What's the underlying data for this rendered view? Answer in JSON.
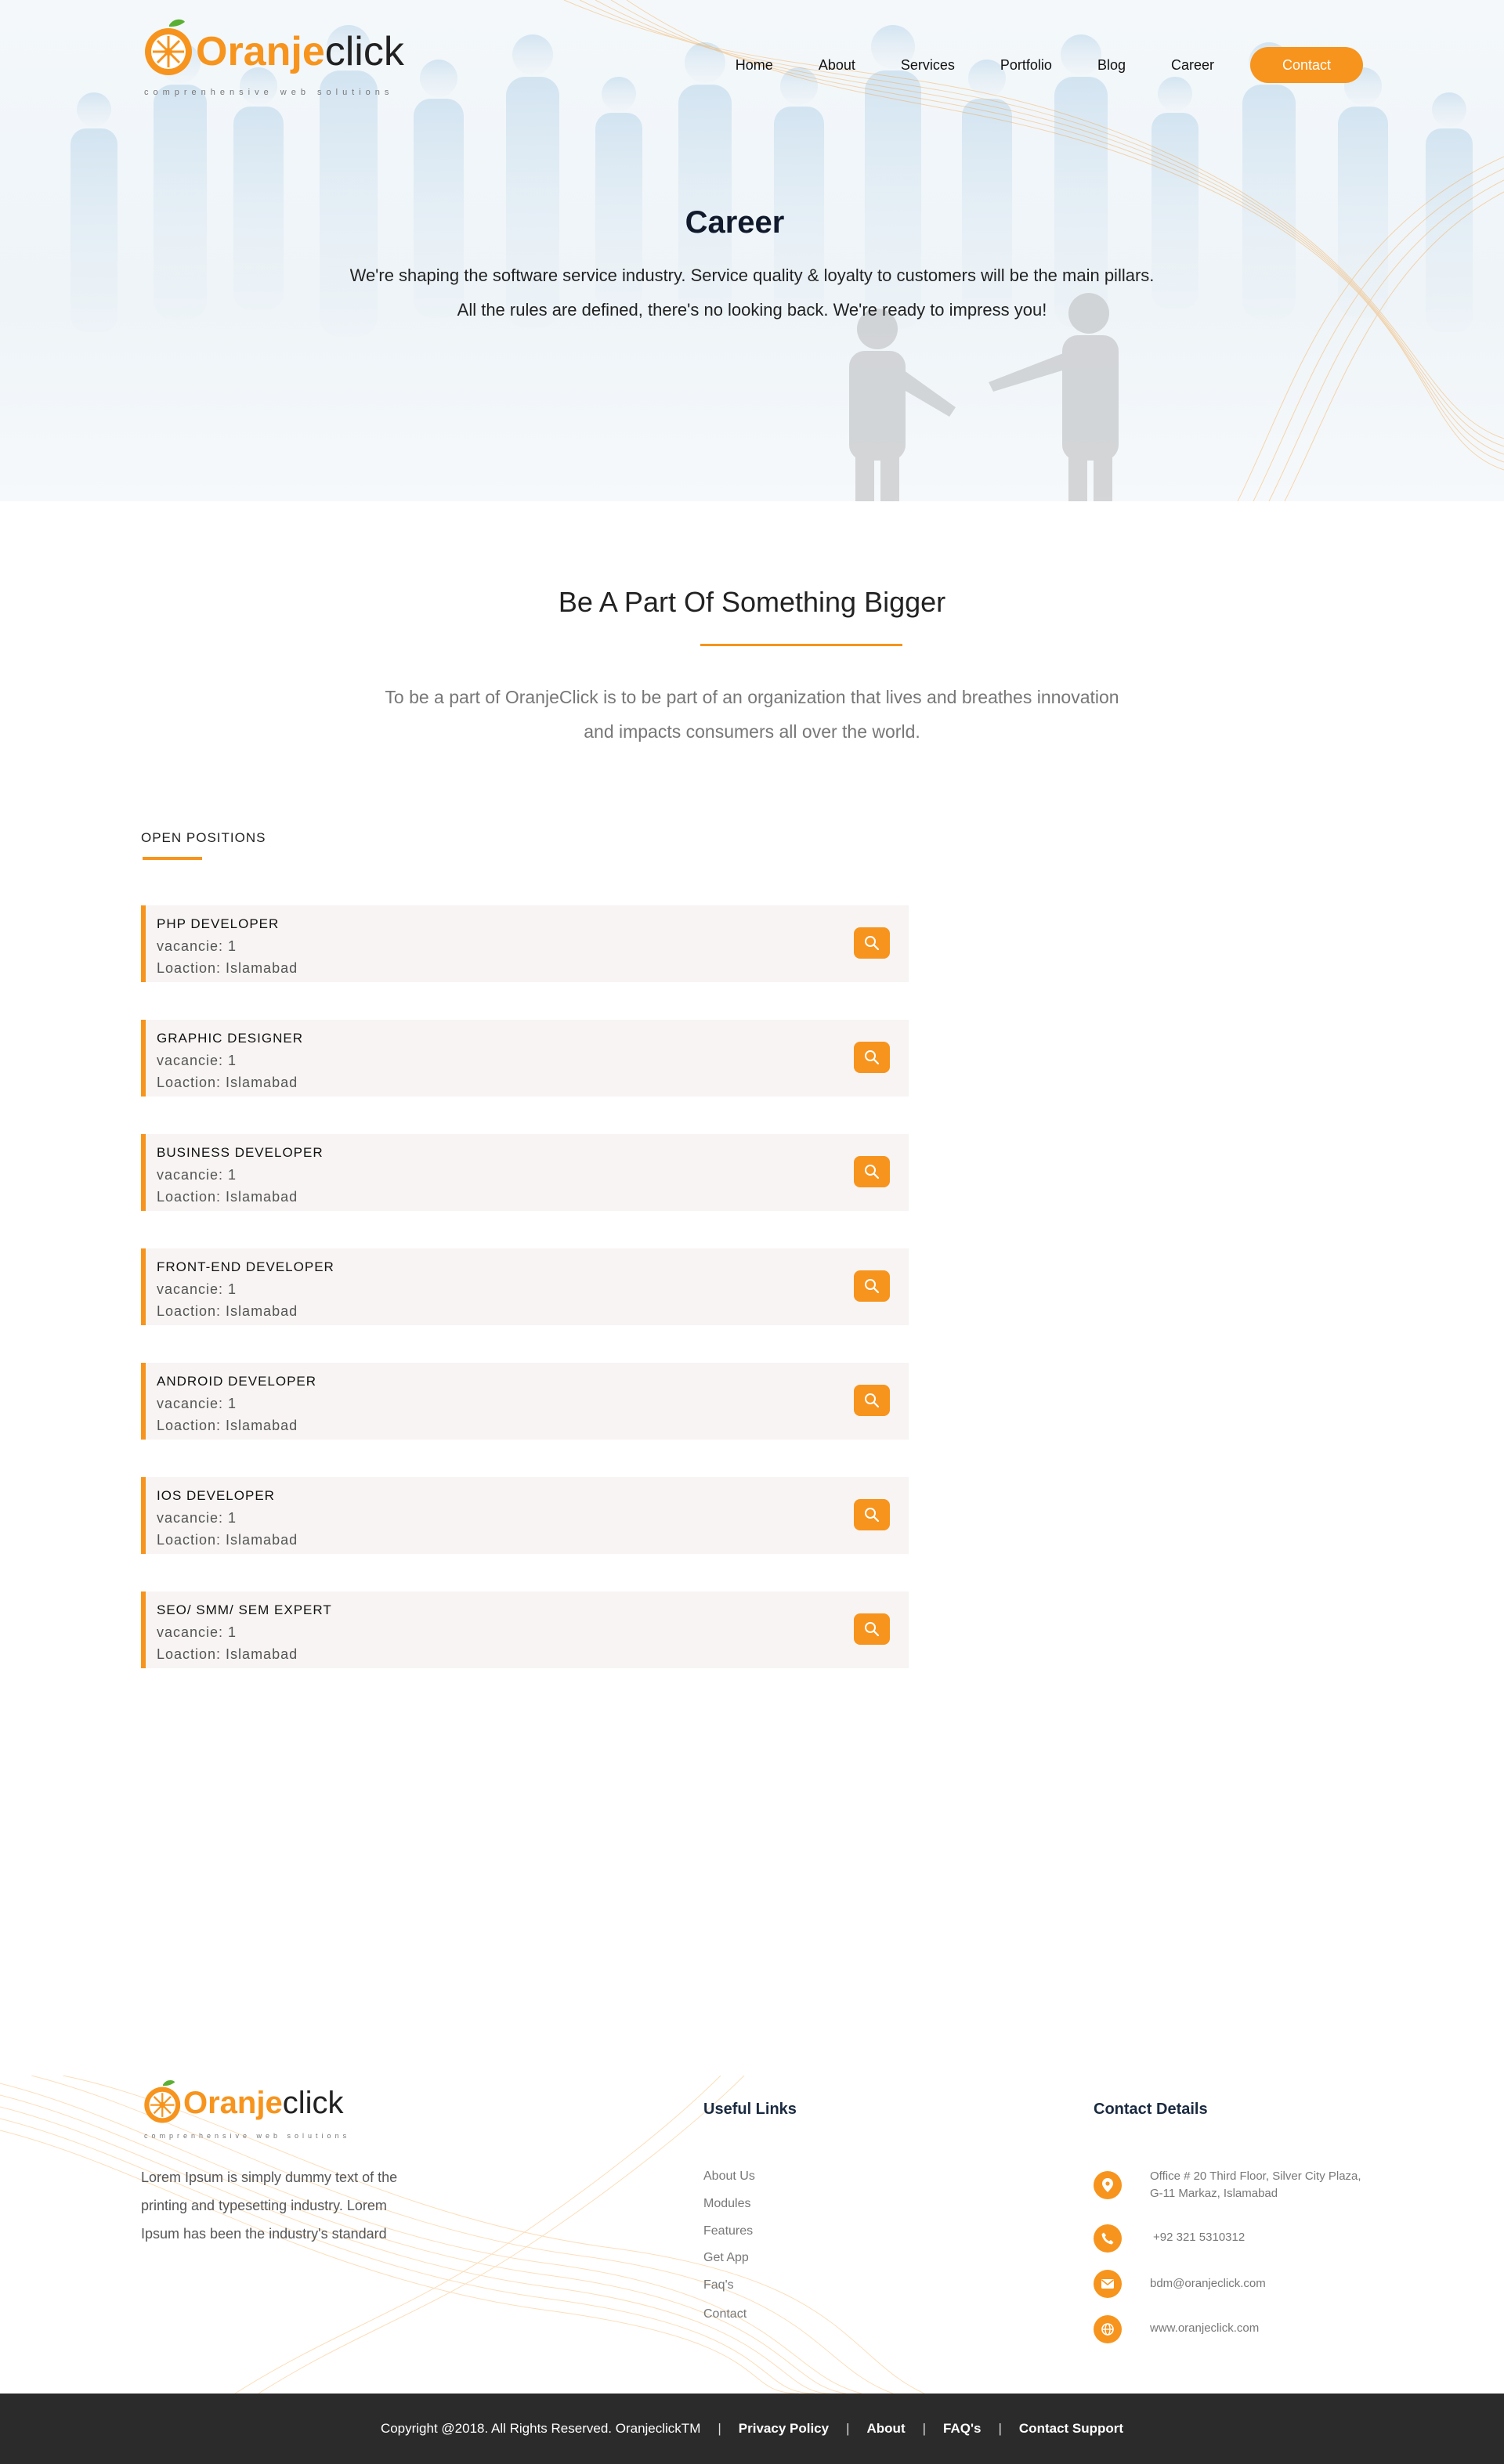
{
  "brand": {
    "name_part1": "Oranje",
    "name_part2": "click",
    "tagline": "comprenhensive web solutions"
  },
  "nav": {
    "items": [
      "Home",
      "About",
      "Services",
      "Portfolio",
      "Blog",
      "Career"
    ],
    "contact_label": "Contact"
  },
  "hero": {
    "title": "Career",
    "line1": "We're shaping the software service industry. Service quality & loyalty to customers will be the main pillars.",
    "line2": "All the rules are defined, there's no looking back. We're ready to impress you!"
  },
  "intro": {
    "title": "Be A Part Of Something Bigger",
    "line1": "To be a part of OranjeClick is to be part of an organization that lives and breathes innovation",
    "line2": "and impacts consumers all over the world."
  },
  "positions": {
    "heading": "OPEN POSITIONS",
    "jobs": [
      {
        "title": "PHP DEVELOPER",
        "vacancy": "vacancie: 1",
        "location": "Loaction: Islamabad"
      },
      {
        "title": "GRAPHIC DESIGNER",
        "vacancy": "vacancie: 1",
        "location": "Loaction: Islamabad"
      },
      {
        "title": "BUSINESS DEVELOPER",
        "vacancy": "vacancie: 1",
        "location": "Loaction: Islamabad"
      },
      {
        "title": "FRONT-END DEVELOPER",
        "vacancy": "vacancie: 1",
        "location": "Loaction: Islamabad"
      },
      {
        "title": "ANDROID DEVELOPER",
        "vacancy": "vacancie: 1",
        "location": "Loaction: Islamabad"
      },
      {
        "title": "IOS DEVELOPER",
        "vacancy": "vacancie: 1",
        "location": "Loaction: Islamabad"
      },
      {
        "title": "SEO/ SMM/ SEM EXPERT",
        "vacancy": "vacancie: 1",
        "location": "Loaction: Islamabad"
      }
    ]
  },
  "footer": {
    "description": "Lorem Ipsum is simply dummy text of the printing and typesetting industry. Lorem Ipsum has been the industry's standard",
    "useful_links_heading": "Useful Links",
    "useful_links": [
      "About Us",
      "Modules",
      "Features",
      "Get App",
      "Faq's",
      "Contact"
    ],
    "contact_heading": "Contact Details",
    "address_line1": "Office # 20 Third Floor, Silver City Plaza,",
    "address_line2": "G-11 Markaz, Islamabad",
    "phone": "+92 321 5310312",
    "email": "bdm@oranjeclick.com",
    "website": "www.oranjeclick.com"
  },
  "bottom_bar": {
    "copyright": "Copyright @2018. All Rights Reserved. OranjeclickTM",
    "links": [
      "Privacy Policy",
      "About",
      "FAQ's",
      "Contact Support"
    ]
  },
  "colors": {
    "accent": "#f7941d",
    "dark_text": "#101a2c",
    "bottom_bar": "#2b2b2b",
    "job_card_bg": "#f7f4f3"
  },
  "icons": {
    "job_button": "search-icon",
    "address": "location-pin-icon",
    "phone": "phone-icon",
    "email": "mail-icon",
    "website": "globe-icon"
  }
}
